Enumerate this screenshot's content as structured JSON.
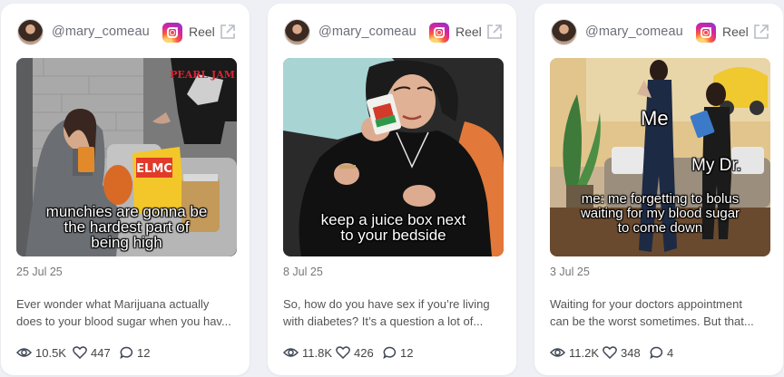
{
  "cards": [
    {
      "handle": "@mary_comeau",
      "platform_label": "Reel",
      "caption_lines": [
        "munchies are gonna be",
        "the hardest part of",
        "being high"
      ],
      "shirt_text": "PEARL JAM",
      "bag_text": "ELMC",
      "date": "25 Jul 25",
      "description": [
        "Ever wonder what Marijuana actually",
        "does to your blood sugar when you hav..."
      ],
      "views": "10.5K",
      "likes": "447",
      "comments": "12"
    },
    {
      "handle": "@mary_comeau",
      "platform_label": "Reel",
      "caption_lines": [
        "keep a juice box next",
        "to your bedside"
      ],
      "date": "8 Jul 25",
      "description": [
        "So, how do you have sex if you’re living",
        "with diabetes? It’s a question a lot of..."
      ],
      "views": "11.8K",
      "likes": "426",
      "comments": "12"
    },
    {
      "handle": "@mary_comeau",
      "platform_label": "Reel",
      "overlay_me": "Me",
      "overlay_dr": "My Dr.",
      "caption_lines": [
        "me: me forgetting to bolus",
        "waiting for my blood sugar",
        "to come down"
      ],
      "date": "3 Jul 25",
      "description": [
        "Waiting for your doctors appointment",
        "can be the worst sometimes. But that..."
      ],
      "views": "11.2K",
      "likes": "348",
      "comments": "4"
    }
  ]
}
